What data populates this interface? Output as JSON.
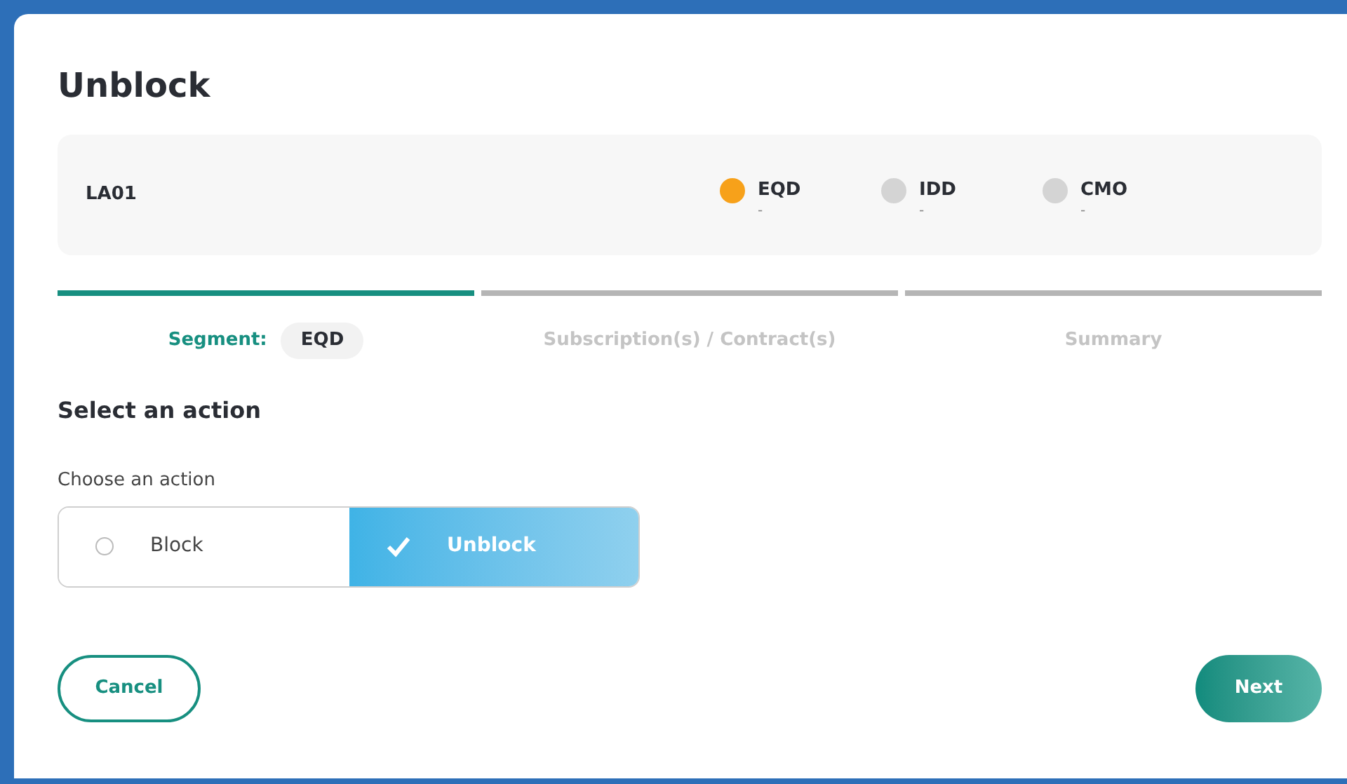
{
  "dialog": {
    "title": "Unblock"
  },
  "summary": {
    "account": "LA01",
    "segments": [
      {
        "name": "EQD",
        "value": "-",
        "color": "#f7a11a"
      },
      {
        "name": "IDD",
        "value": "-",
        "color": "#d4d4d4"
      },
      {
        "name": "CMO",
        "value": "-",
        "color": "#d4d4d4"
      }
    ]
  },
  "steps": [
    {
      "label": "Segment:",
      "badge": "EQD",
      "selected": true
    },
    {
      "label": "Subscription(s) / Contract(s)",
      "selected": false
    },
    {
      "label": "Summary",
      "selected": false
    }
  ],
  "section_title": "Select an action",
  "action_field": {
    "label": "Choose an action",
    "options": [
      {
        "label": "Block",
        "selected": false
      },
      {
        "label": "Unblock",
        "selected": true
      }
    ]
  },
  "buttons": {
    "cancel": "Cancel",
    "next": "Next"
  }
}
